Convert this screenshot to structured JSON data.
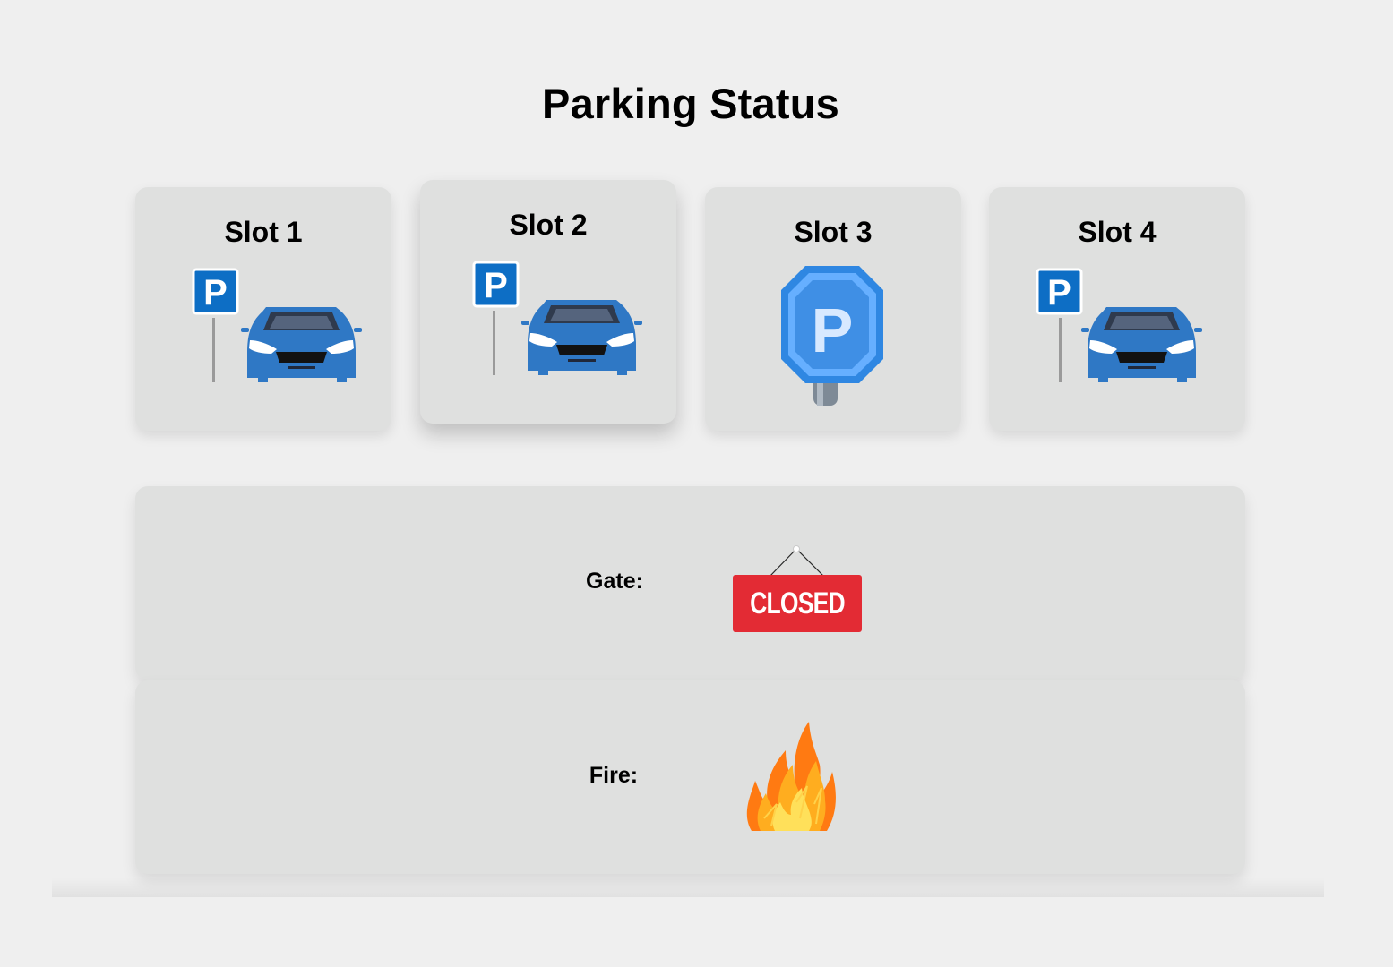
{
  "page": {
    "title": "Parking Status"
  },
  "slots": [
    {
      "label": "Slot 1",
      "status": "occupied",
      "icon": "parked-car-icon"
    },
    {
      "label": "Slot 2",
      "status": "occupied",
      "icon": "parked-car-icon"
    },
    {
      "label": "Slot 3",
      "status": "available",
      "icon": "parking-sign-icon"
    },
    {
      "label": "Slot 4",
      "status": "occupied",
      "icon": "parked-car-icon"
    }
  ],
  "gate": {
    "label": "Gate:",
    "status_text": "CLOSED",
    "status_color": "#e32b34"
  },
  "fire": {
    "label": "Fire:",
    "icon": "fire-icon"
  },
  "colors": {
    "background": "#efefef",
    "card": "#dfe0df",
    "parking_blue": "#1773c6",
    "car_blue": "#2f78c5"
  }
}
